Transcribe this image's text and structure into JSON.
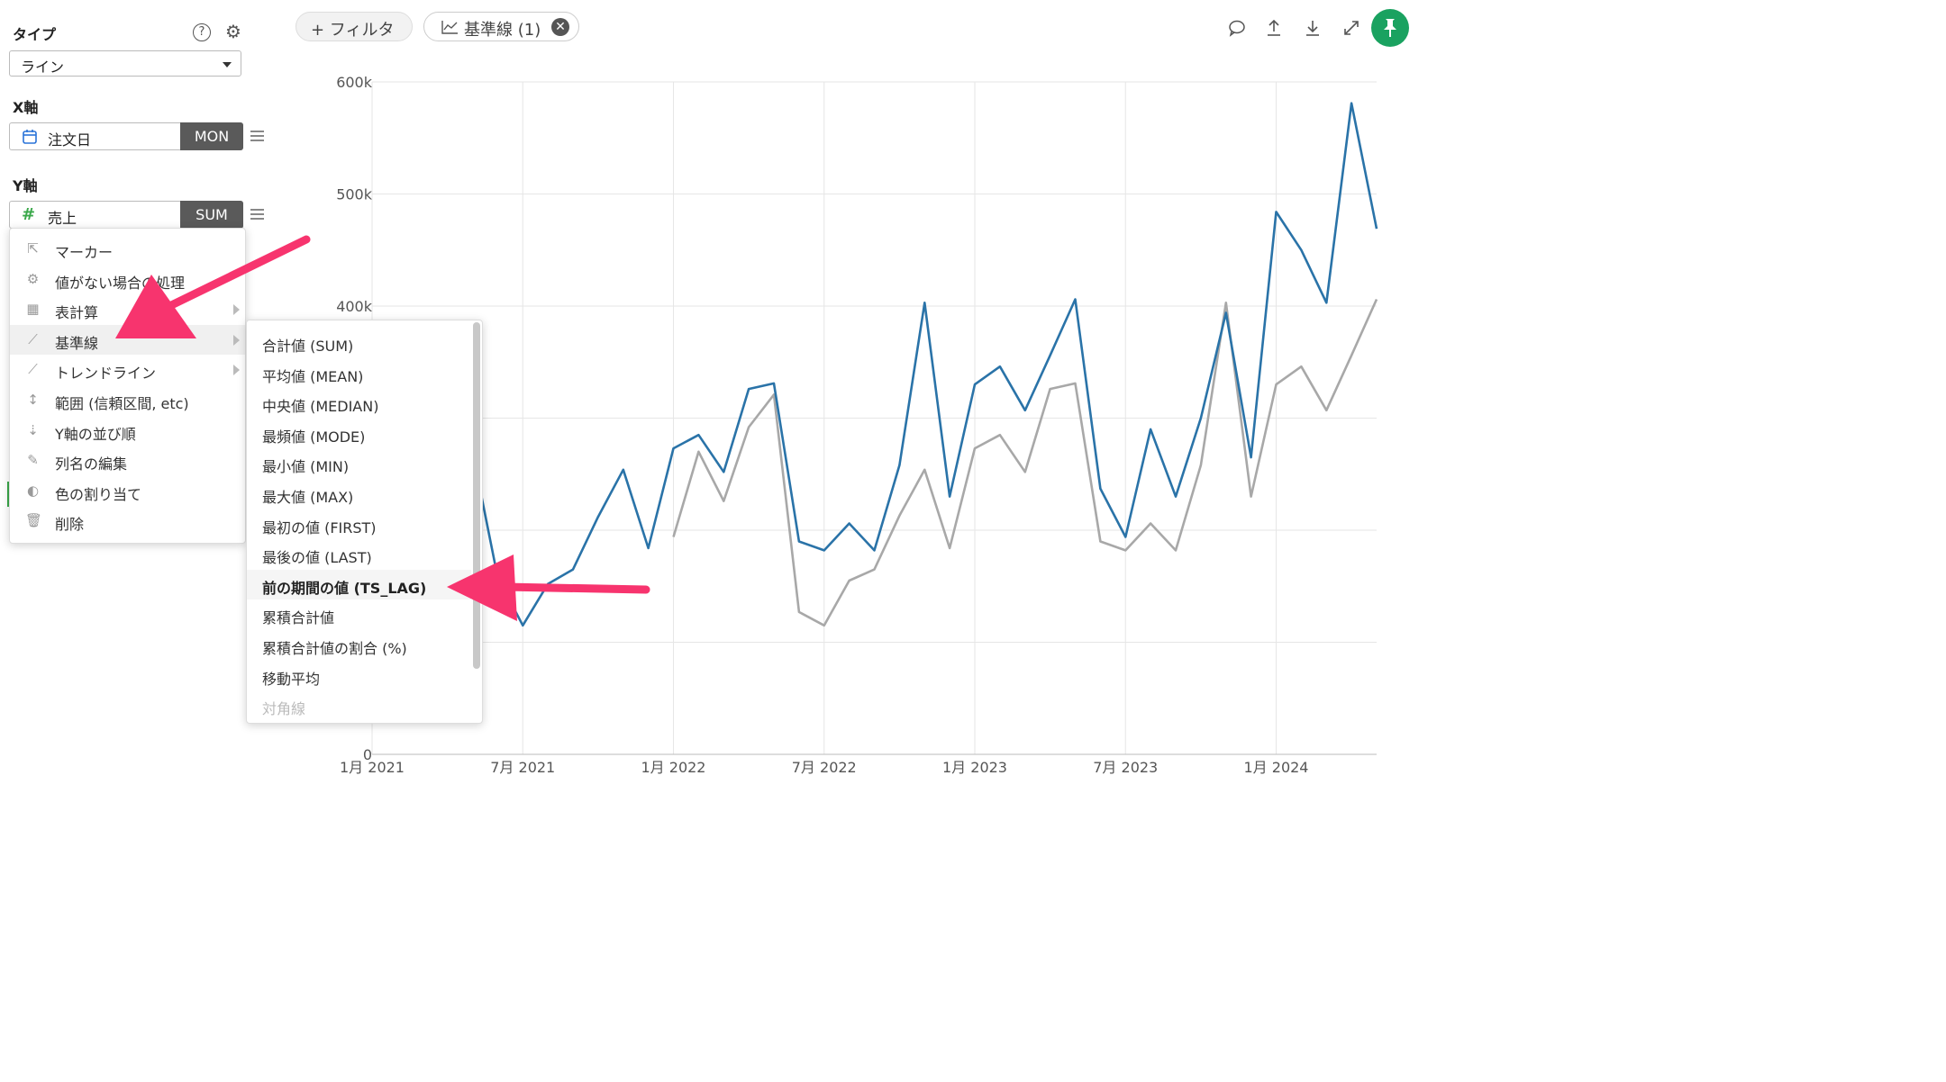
{
  "panel": {
    "type_label": "タイプ",
    "type_value": "ライン",
    "x_label": "X軸",
    "x_field": "注文日",
    "x_agg": "MON",
    "y_label": "Y軸",
    "y_field": "売上",
    "y_agg": "SUM"
  },
  "topbar": {
    "filter_label": "+ フィルタ",
    "reference_label": "基準線 (1)"
  },
  "menu": {
    "items": [
      {
        "label": "マーカー",
        "icon": "cursor-icon"
      },
      {
        "label": "値がない場合の処理",
        "icon": "gear-icon"
      },
      {
        "label": "表計算",
        "icon": "table-icon"
      },
      {
        "label": "基準線",
        "icon": "chart-line-icon"
      },
      {
        "label": "トレンドライン",
        "icon": "trend-icon"
      },
      {
        "label": "範囲 (信頼区間, etc)",
        "icon": "range-icon"
      },
      {
        "label": "Y軸の並び順",
        "icon": "sort-icon"
      },
      {
        "label": "列名の編集",
        "icon": "edit-icon"
      },
      {
        "label": "色の割り当て",
        "icon": "palette-icon"
      },
      {
        "label": "削除",
        "icon": "trash-icon"
      }
    ]
  },
  "submenu": {
    "items": [
      "合計値 (SUM)",
      "平均値 (MEAN)",
      "中央値 (MEDIAN)",
      "最頻値 (MODE)",
      "最小値 (MIN)",
      "最大値 (MAX)",
      "最初の値 (FIRST)",
      "最後の値 (LAST)",
      "前の期間の値 (TS_LAG)",
      "累積合計値",
      "累積合計値の割合 (%)",
      "移動平均",
      "対角線"
    ]
  },
  "colors": {
    "primary": "#2a73a8",
    "reference": "#a8a8a8",
    "accent": "#f7346e",
    "pin": "#1aa260"
  },
  "chart_data": {
    "type": "line",
    "x": [
      "2021-01",
      "2021-02",
      "2021-03",
      "2021-04",
      "2021-05",
      "2021-06",
      "2021-07",
      "2021-08",
      "2021-09",
      "2021-10",
      "2021-11",
      "2021-12",
      "2022-01",
      "2022-02",
      "2022-03",
      "2022-04",
      "2022-05",
      "2022-06",
      "2022-07",
      "2022-08",
      "2022-09",
      "2022-10",
      "2022-11",
      "2022-12",
      "2023-01",
      "2023-02",
      "2023-03",
      "2023-04",
      "2023-05",
      "2023-06",
      "2023-07",
      "2023-08",
      "2023-09",
      "2023-10",
      "2023-11",
      "2023-12",
      "2024-01",
      "2024-02",
      "2024-03",
      "2024-04",
      "2024-05",
      "2024-06",
      "2024-07"
    ],
    "ylim": [
      0,
      600000
    ],
    "yticks": [
      "0",
      "100k",
      "200k",
      "300k",
      "400k",
      "500k",
      "600k"
    ],
    "xticks": [
      "1月 2021",
      "7月 2021",
      "1月 2022",
      "7月 2022",
      "1月 2023",
      "7月 2023",
      "1月 2024"
    ],
    "series": [
      {
        "values": [
          null,
          null,
          null,
          null,
          270000,
          158000,
          115000,
          152000,
          165000,
          212000,
          254000,
          184000,
          273000,
          285000,
          252000,
          326000,
          331000,
          190000,
          182000,
          206000,
          182000,
          258000,
          403000,
          230000,
          330000,
          346000,
          307000,
          356000,
          406000,
          237000,
          194000,
          290000,
          230000,
          300000,
          394000,
          265000,
          484000,
          450000,
          403000,
          581000,
          469000,
          null,
          null
        ]
      },
      {
        "values": [
          null,
          null,
          null,
          null,
          null,
          null,
          null,
          null,
          null,
          null,
          null,
          null,
          194000,
          270000,
          226000,
          292000,
          321000,
          127000,
          115000,
          155000,
          165000,
          213000,
          254000,
          184000,
          273000,
          285000,
          252000,
          326000,
          331000,
          190000,
          182000,
          206000,
          182000,
          258000,
          403000,
          230000,
          330000,
          346000,
          307000,
          356000,
          406000,
          null,
          null
        ]
      }
    ]
  }
}
